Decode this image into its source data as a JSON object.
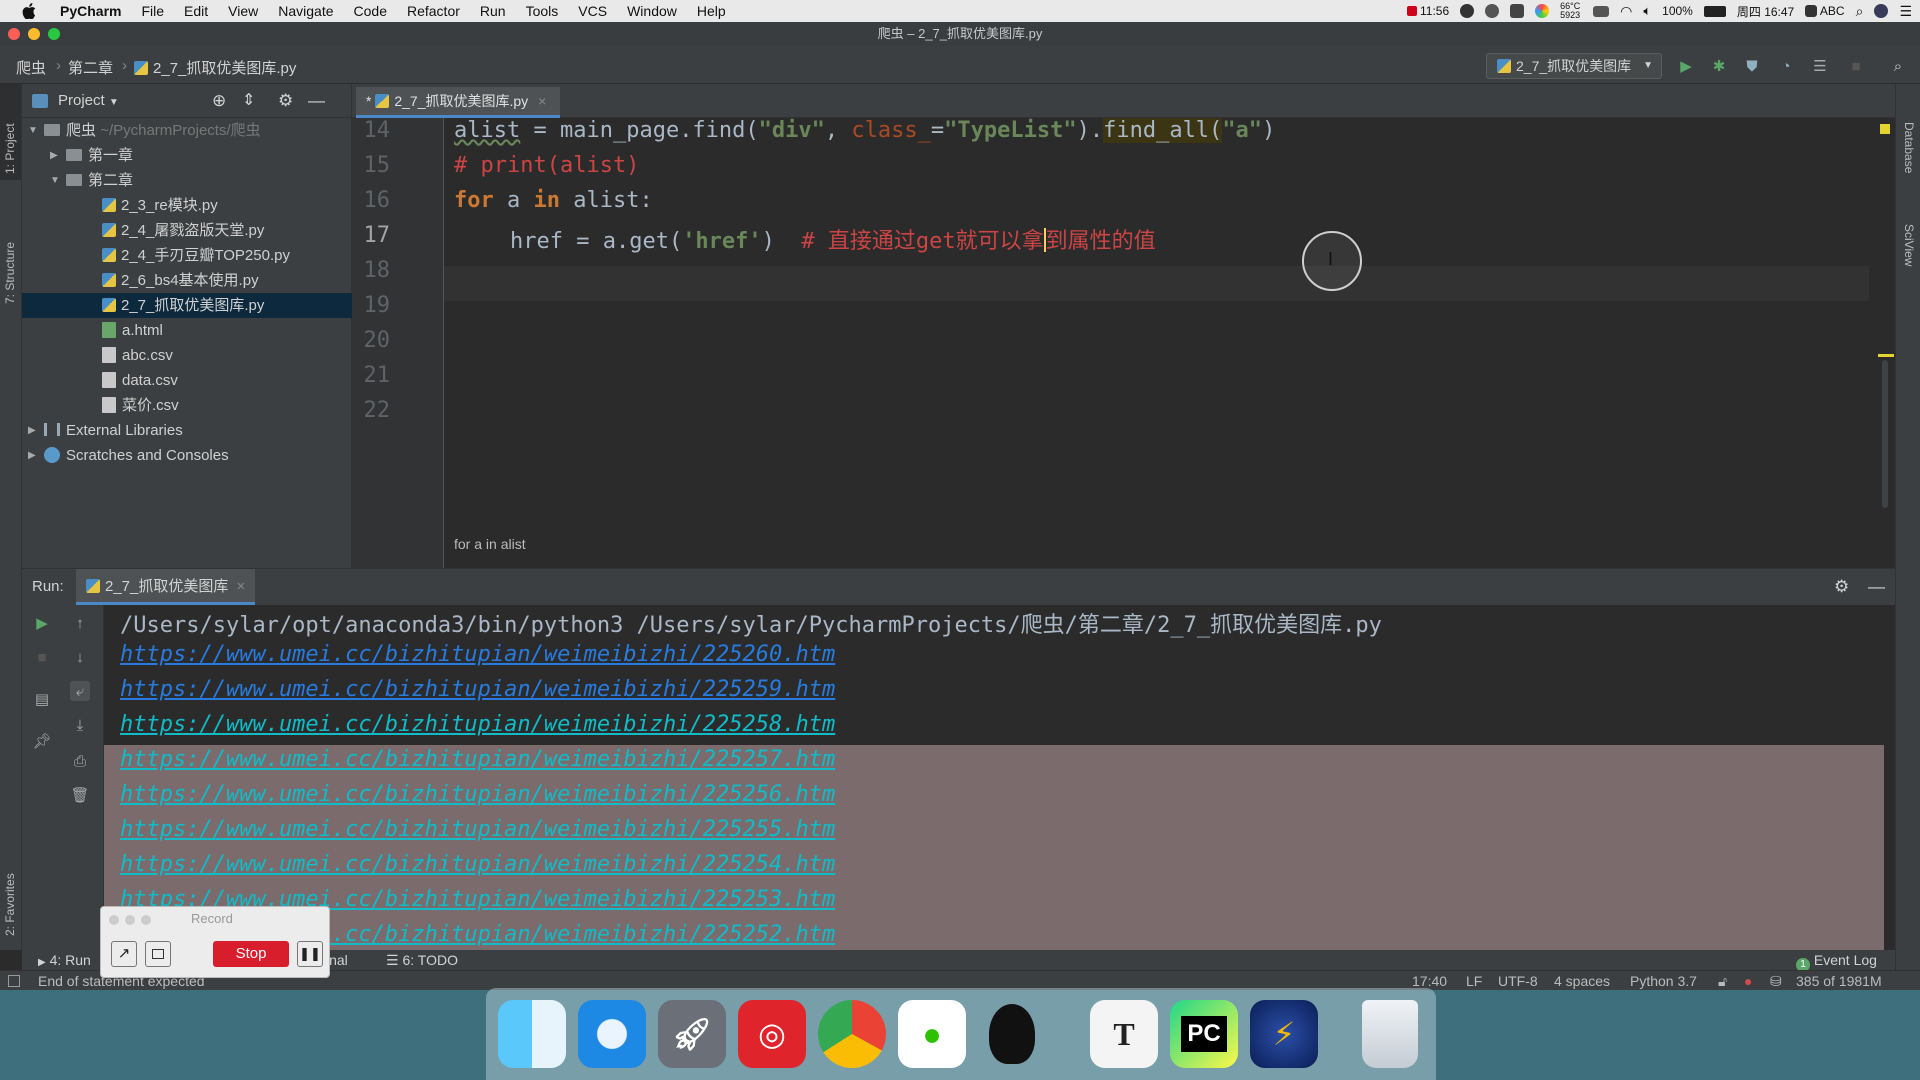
{
  "menubar": {
    "app_name": "PyCharm",
    "items": [
      "File",
      "Edit",
      "View",
      "Navigate",
      "Code",
      "Refactor",
      "Run",
      "Tools",
      "VCS",
      "Window",
      "Help"
    ],
    "status": {
      "timer": "11:56",
      "weather": "66°C 5923",
      "battery": "100%",
      "datetime": "周四 16:47",
      "input_method": "ABC"
    }
  },
  "window": {
    "title": "爬虫 – 2_7_抓取优美图库.py"
  },
  "navbar": {
    "crumbs": [
      "爬虫",
      "第二章",
      "2_7_抓取优美图库.py"
    ],
    "run_config": "2_7_抓取优美图库"
  },
  "left_strip": {
    "project": "1: Project",
    "structure": "7: Structure",
    "favorites": "2: Favorites"
  },
  "right_strip": {
    "database": "Database",
    "sciview": "SciView"
  },
  "project_panel": {
    "header": "Project",
    "tree": [
      {
        "label": "爬虫",
        "suffix": "~/PycharmProjects/爬虫",
        "type": "folder"
      },
      {
        "label": "第一章",
        "type": "folder"
      },
      {
        "label": "第二章",
        "type": "folder"
      },
      {
        "label": "2_3_re模块.py",
        "type": "py"
      },
      {
        "label": "2_4_屠戮盗版天堂.py",
        "type": "py"
      },
      {
        "label": "2_4_手刃豆瓣TOP250.py",
        "type": "py"
      },
      {
        "label": "2_6_bs4基本使用.py",
        "type": "py"
      },
      {
        "label": "2_7_抓取优美图库.py",
        "type": "py"
      },
      {
        "label": "a.html",
        "type": "html"
      },
      {
        "label": "abc.csv",
        "type": "csv"
      },
      {
        "label": "data.csv",
        "type": "csv"
      },
      {
        "label": "菜价.csv",
        "type": "csv"
      },
      {
        "label": "External Libraries",
        "type": "lib"
      },
      {
        "label": "Scratches and Consoles",
        "type": "scratch"
      }
    ]
  },
  "editor": {
    "tab_label": "2_7_抓取优美图库.py",
    "line_numbers": [
      "14",
      "15",
      "16",
      "17",
      "18",
      "19",
      "20",
      "21",
      "22"
    ],
    "lines": {
      "l14": {
        "var": "alist",
        "op": " = ",
        "call": "main_page.find(",
        "s1": "\"div\"",
        "comma": ", ",
        "kwarg": "class_",
        "eq": "=",
        "s2": "\"TypeList\"",
        "close": ").",
        "call2": "find_all(",
        "s3": "\"a\"",
        "end": ")"
      },
      "l15": "# print(alist)",
      "l16": {
        "kw1": "for",
        "mid1": " a ",
        "kw2": "in",
        "mid2": " alist:"
      },
      "l17": {
        "code": "href = a.get(",
        "s": "'href'",
        "close": ")",
        "comment_a": "  # 直接通过get就可以拿",
        "comment_b": "到属性的值"
      }
    },
    "breadcrumb": "for a in alist"
  },
  "run_panel": {
    "label": "Run:",
    "tab": "2_7_抓取优美图库",
    "command": "/Users/sylar/opt/anaconda3/bin/python3 /Users/sylar/PycharmProjects/爬虫/第二章/2_7_抓取优美图库.py",
    "urls": [
      "https://www.umei.cc/bizhitupian/weimeibizhi/225260.htm",
      "https://www.umei.cc/bizhitupian/weimeibizhi/225259.htm",
      "https://www.umei.cc/bizhitupian/weimeibizhi/225258.htm",
      "https://www.umei.cc/bizhitupian/weimeibizhi/225257.htm",
      "https://www.umei.cc/bizhitupian/weimeibizhi/225256.htm",
      "https://www.umei.cc/bizhitupian/weimeibizhi/225255.htm",
      "https://www.umei.cc/bizhitupian/weimeibizhi/225254.htm",
      "https://www.umei.cc/bizhitupian/weimeibizhi/225253.htm",
      "https://www.umei.cc/bizhitupian/weimeibizhi/225252.htm"
    ]
  },
  "bottom_tools": {
    "run": "4: Run",
    "terminal": "inal",
    "todo": "6: TODO",
    "event_log": "Event Log"
  },
  "statusbar": {
    "message": "End of statement expected",
    "position": "17:40",
    "line_sep": "LF",
    "encoding": "UTF-8",
    "indent": "4 spaces",
    "interpreter": "Python 3.7",
    "memory": "385 of 1981M"
  },
  "record_popup": {
    "title": "Record",
    "stop": "Stop"
  },
  "colors": {
    "accent": "#4a88c7",
    "selection": "#7b6b6d",
    "link": "#287bde",
    "stop": "#d81e2c"
  }
}
